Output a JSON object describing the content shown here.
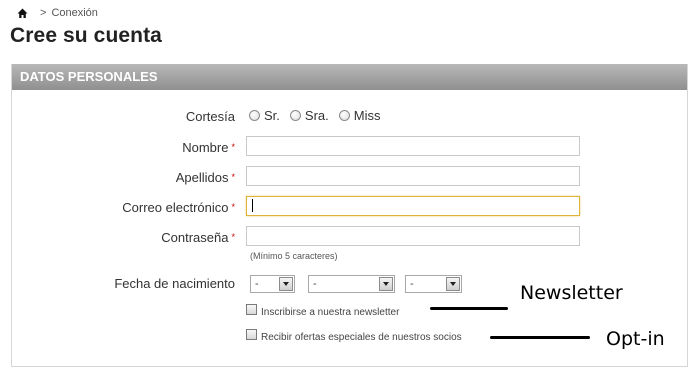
{
  "breadcrumb": {
    "separator": ">",
    "current": "Conexión"
  },
  "page_title": "Cree su cuenta",
  "panel": {
    "title": "DATOS PERSONALES"
  },
  "form": {
    "title_label": "Cortesía",
    "title_options": [
      "Sr.",
      "Sra.",
      "Miss"
    ],
    "firstname_label": "Nombre",
    "lastname_label": "Apellidos",
    "email_label": "Correo electrónico",
    "password_label": "Contraseña",
    "required_mark": "*",
    "password_hint": "(Mínimo 5 caracteres)",
    "birthdate_label": "Fecha de nacimiento",
    "birthdate_day": "-",
    "birthdate_month": "-",
    "birthdate_year": "-",
    "newsletter_label": "Inscribirse a nuestra newsletter",
    "optin_label": "Recibir ofertas especiales de nuestros socios"
  },
  "annotations": {
    "newsletter": "Newsletter",
    "optin": "Opt-in"
  }
}
